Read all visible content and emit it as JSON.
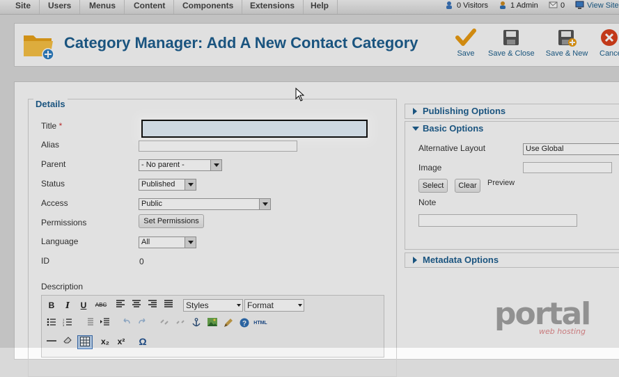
{
  "menu": {
    "items": [
      "Site",
      "Users",
      "Menus",
      "Content",
      "Components",
      "Extensions",
      "Help"
    ]
  },
  "status": {
    "visitors": "0 Visitors",
    "admins": "1 Admin",
    "messages": "0",
    "view_site": "View Site"
  },
  "toolbar": {
    "title": "Category Manager: Add A New Contact Category",
    "buttons": {
      "save": "Save",
      "save_close": "Save & Close",
      "save_new": "Save & New",
      "cancel": "Cancel"
    }
  },
  "details": {
    "legend": "Details",
    "title_label": "Title",
    "required_mark": "*",
    "title_value": "",
    "alias_label": "Alias",
    "alias_value": "",
    "parent_label": "Parent",
    "parent_value": "- No parent -",
    "status_label": "Status",
    "status_value": "Published",
    "access_label": "Access",
    "access_value": "Public",
    "permissions_label": "Permissions",
    "permissions_button": "Set Permissions",
    "language_label": "Language",
    "language_value": "All",
    "id_label": "ID",
    "id_value": "0",
    "description_label": "Description"
  },
  "editor": {
    "styles_label": "Styles",
    "format_label": "Format",
    "bold": "B",
    "italic": "I",
    "underline": "U",
    "strike": "ABC",
    "html": "HTML",
    "subscript": "x₂",
    "superscript": "x²",
    "omega": "Ω"
  },
  "panels": {
    "publishing": "Publishing Options",
    "basic": "Basic Options",
    "alt_layout_label": "Alternative Layout",
    "alt_layout_value": "Use Global",
    "image_label": "Image",
    "select_button": "Select",
    "clear_button": "Clear",
    "preview_label": "Preview",
    "note_label": "Note",
    "metadata": "Metadata Options"
  },
  "watermark": {
    "brand": "portal",
    "tagline": "web hosting"
  }
}
